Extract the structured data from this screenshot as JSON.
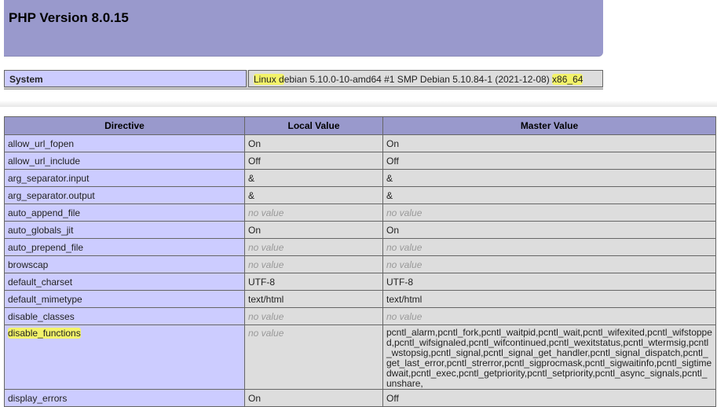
{
  "title": "PHP Version 8.0.15",
  "system": {
    "label": "System",
    "value_parts": [
      "Linux d",
      "ebian 5.10.0-10-amd64 #1 SMP Debian 5.10.84-1 (2021-12-08) ",
      "x86_64"
    ]
  },
  "table": {
    "headers": [
      "Directive",
      "Local Value",
      "Master Value"
    ],
    "rows": [
      {
        "name": "allow_url_fopen",
        "local": "On",
        "master": "On"
      },
      {
        "name": "allow_url_include",
        "local": "Off",
        "master": "Off"
      },
      {
        "name": "arg_separator.input",
        "local": "&",
        "master": "&"
      },
      {
        "name": "arg_separator.output",
        "local": "&",
        "master": "&"
      },
      {
        "name": "auto_append_file",
        "local": "no value",
        "master": "no value"
      },
      {
        "name": "auto_globals_jit",
        "local": "On",
        "master": "On"
      },
      {
        "name": "auto_prepend_file",
        "local": "no value",
        "master": "no value"
      },
      {
        "name": "browscap",
        "local": "no value",
        "master": "no value"
      },
      {
        "name": "default_charset",
        "local": "UTF-8",
        "master": "UTF-8"
      },
      {
        "name": "default_mimetype",
        "local": "text/html",
        "master": "text/html"
      },
      {
        "name": "disable_classes",
        "local": "no value",
        "master": "no value"
      },
      {
        "name": "disable_functions",
        "local": "no value",
        "master": "pcntl_alarm,pcntl_fork,pcntl_waitpid,pcntl_wait,pcntl_wifexited,pcntl_wifstopped,pcntl_wifsignaled,pcntl_wifcontinued,pcntl_wexitstatus,pcntl_wtermsig,pcntl_wstopsig,pcntl_signal,pcntl_signal_get_handler,pcntl_signal_dispatch,pcntl_get_last_error,pcntl_strerror,pcntl_sigprocmask,pcntl_sigwaitinfo,pcntl_sigtimedwait,pcntl_exec,pcntl_getpriority,pcntl_setpriority,pcntl_async_signals,pcntl_unshare,"
      },
      {
        "name": "display_errors",
        "local": "On",
        "master": "Off"
      }
    ]
  },
  "highlight_color": "#f3f36a"
}
